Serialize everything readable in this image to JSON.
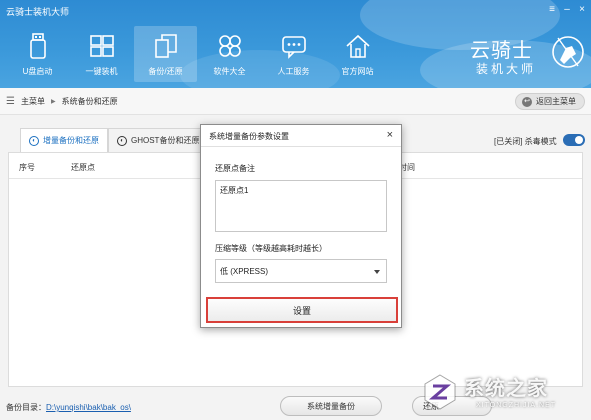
{
  "app": {
    "title": "云骑士装机大师",
    "window_controls": {
      "menu": "≡",
      "minimize": "–",
      "close": "×"
    }
  },
  "nav": [
    {
      "label": "U盘启动",
      "icon": "usb-drive-icon"
    },
    {
      "label": "一键装机",
      "icon": "windows-grid-icon"
    },
    {
      "label": "备份/还原",
      "icon": "backup-restore-icon",
      "active": true
    },
    {
      "label": "软件大全",
      "icon": "apps-grid-icon"
    },
    {
      "label": "人工服务",
      "icon": "chat-bubble-icon"
    },
    {
      "label": "官方网站",
      "icon": "home-icon"
    }
  ],
  "logo": {
    "line1": "云骑士",
    "line2": "装机大师"
  },
  "breadcrumb": {
    "root": "主菜单",
    "current": "系统备份和还原",
    "back_label": "返回主菜单"
  },
  "tabs": [
    {
      "label": "增量备份和还原",
      "active": true
    },
    {
      "label": "GHOST备份和还原",
      "active": false
    }
  ],
  "antivirus": {
    "status": "[已关闭]",
    "label": "杀毒模式"
  },
  "table": {
    "columns": [
      "序号",
      "还原点",
      "时间"
    ]
  },
  "footer": {
    "dir_label": "备份目录：",
    "dir_path": "D:\\yunqishi\\bak\\bak_os\\",
    "btn_incremental": "系统增量备份",
    "btn_restore": "还原"
  },
  "modal": {
    "title": "系统增量备份参数设置",
    "close": "×",
    "note_label": "还原点备注",
    "note_value": "还原点1",
    "compress_label": "压缩等级（等级越高耗时越长）",
    "compress_value": "低 (XPRESS)",
    "set_button": "设置"
  },
  "watermark": {
    "text": "系统之家",
    "sub": "XITONGZHIJIA.NET"
  },
  "colors": {
    "header": "#3a98da",
    "accent": "#1a6fc0",
    "highlight": "#d9403a"
  }
}
